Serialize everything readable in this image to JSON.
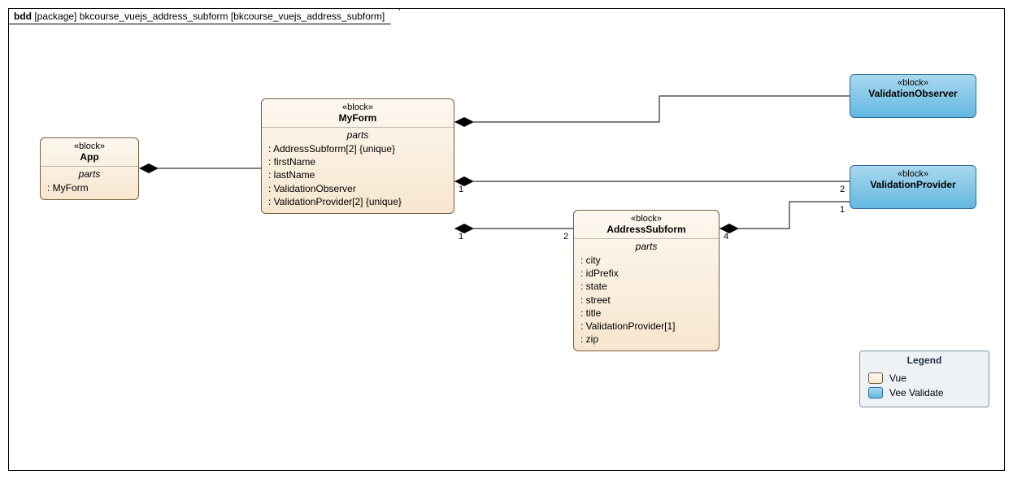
{
  "title": {
    "prefix": "bdd",
    "mid": "[package] bkcourse_vuejs_address_subform [bkcourse_vuejs_address_subform]"
  },
  "blocks": {
    "app": {
      "stereotype": "«block»",
      "name": "App",
      "parts_label": "parts",
      "parts": [
        ": MyForm"
      ]
    },
    "myform": {
      "stereotype": "«block»",
      "name": "MyForm",
      "parts_label": "parts",
      "parts": [
        ": AddressSubform[2] {unique}",
        ": firstName",
        ": lastName",
        ": ValidationObserver",
        ": ValidationProvider[2] {unique}"
      ]
    },
    "address": {
      "stereotype": "«block»",
      "name": "AddressSubform",
      "parts_label": "parts",
      "parts": [
        ": city",
        ": idPrefix",
        ": state",
        ": street",
        ": title",
        ": ValidationProvider[1]",
        ": zip"
      ]
    },
    "observer": {
      "stereotype": "«block»",
      "name": "ValidationObserver"
    },
    "provider": {
      "stereotype": "«block»",
      "name": "ValidationProvider"
    }
  },
  "multiplicities": {
    "myform_provider_src": "1",
    "myform_provider_dst": "2",
    "myform_address_src": "1",
    "myform_address_dst": "2",
    "address_provider_src": "4",
    "address_provider_dst": "1"
  },
  "legend": {
    "title": "Legend",
    "vue": "Vue",
    "vee": "Vee Validate"
  },
  "chart_data": {
    "type": "table",
    "diagram_type": "SysML Block Definition Diagram (bdd)",
    "package": "bkcourse_vuejs_address_subform",
    "blocks": [
      {
        "name": "App",
        "category": "Vue",
        "parts": [
          "MyForm"
        ]
      },
      {
        "name": "MyForm",
        "category": "Vue",
        "parts": [
          "AddressSubform[2] {unique}",
          "firstName",
          "lastName",
          "ValidationObserver",
          "ValidationProvider[2] {unique}"
        ]
      },
      {
        "name": "AddressSubform",
        "category": "Vue",
        "parts": [
          "city",
          "idPrefix",
          "state",
          "street",
          "title",
          "ValidationProvider[1]",
          "zip"
        ]
      },
      {
        "name": "ValidationObserver",
        "category": "Vee Validate"
      },
      {
        "name": "ValidationProvider",
        "category": "Vee Validate"
      }
    ],
    "compositions": [
      {
        "whole": "App",
        "part": "MyForm"
      },
      {
        "whole": "MyForm",
        "part": "ValidationObserver"
      },
      {
        "whole": "MyForm",
        "part": "ValidationProvider",
        "whole_mult": "1",
        "part_mult": "2"
      },
      {
        "whole": "MyForm",
        "part": "AddressSubform",
        "whole_mult": "1",
        "part_mult": "2"
      },
      {
        "whole": "AddressSubform",
        "part": "ValidationProvider",
        "whole_mult": "4",
        "part_mult": "1"
      }
    ],
    "legend": [
      {
        "color": "peach",
        "label": "Vue"
      },
      {
        "color": "blue",
        "label": "Vee Validate"
      }
    ]
  }
}
